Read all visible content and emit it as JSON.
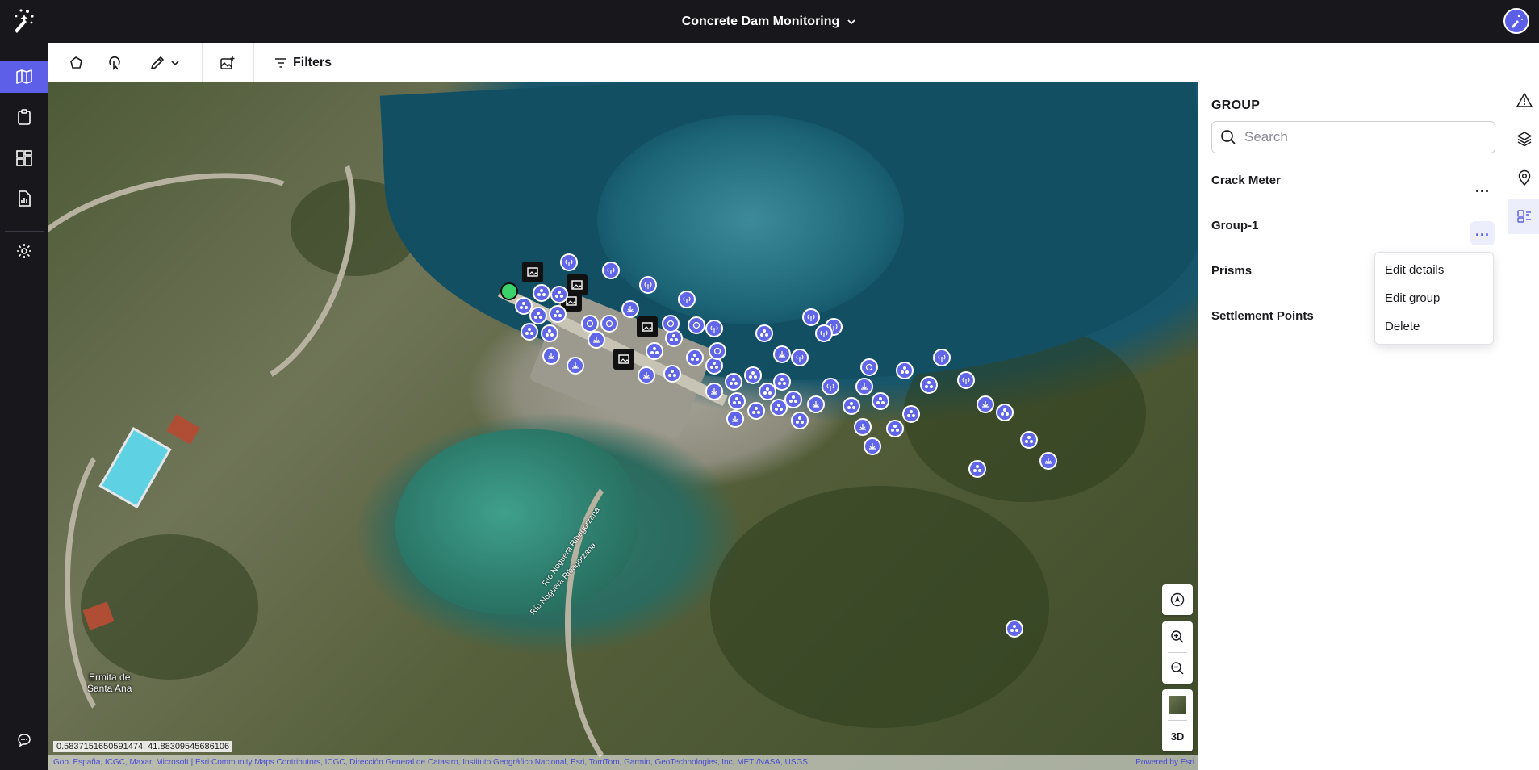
{
  "app": {
    "title": "Concrete Dam Monitoring"
  },
  "colors": {
    "accent": "#5d5fe8",
    "topbar": "#17171c",
    "marker": "#6166e8"
  },
  "leftrail": {
    "items": [
      {
        "icon": "map-icon",
        "active": true
      },
      {
        "icon": "clipboard-icon",
        "active": false
      },
      {
        "icon": "dashboard-icon",
        "active": false
      },
      {
        "icon": "report-icon",
        "active": false
      },
      {
        "icon": "gear-icon",
        "active": false
      },
      {
        "icon": "chat-icon",
        "active": false
      }
    ]
  },
  "toolbar": {
    "tools": [
      "polygon-draw-icon",
      "lasso-select-icon",
      "measure-icon",
      "image-add-icon"
    ],
    "filters_label": "Filters"
  },
  "map": {
    "coords": "0.58371516505914​74, 41.88309545686106",
    "attribution": "Gob. España, ICGC, Maxar, Microsoft | Esri Community Maps Contributors, ICGC, Dirección General de Catastro, Instituto Geográfico Nacional, Esri, TomTom, Garmin, GeoTechnologies, Inc, METI/NASA, USGS",
    "powered_by": "Powered by Esri",
    "place_label_line1": "Ermita de",
    "place_label_line2": "Santa Ana",
    "river_label": "Río Noguera Ribagorzana",
    "view_3d": "3D"
  },
  "panel": {
    "title": "GROUP",
    "search_placeholder": "Search",
    "groups": [
      {
        "label": "Crack Meter"
      },
      {
        "label": "Group-1"
      },
      {
        "label": "Prisms"
      },
      {
        "label": "Settlement Points"
      }
    ],
    "menu": [
      "Edit details",
      "Edit group",
      "Delete"
    ]
  },
  "rightrail": [
    "alert-icon",
    "layers-icon",
    "location-pin-icon",
    "groups-icon"
  ]
}
